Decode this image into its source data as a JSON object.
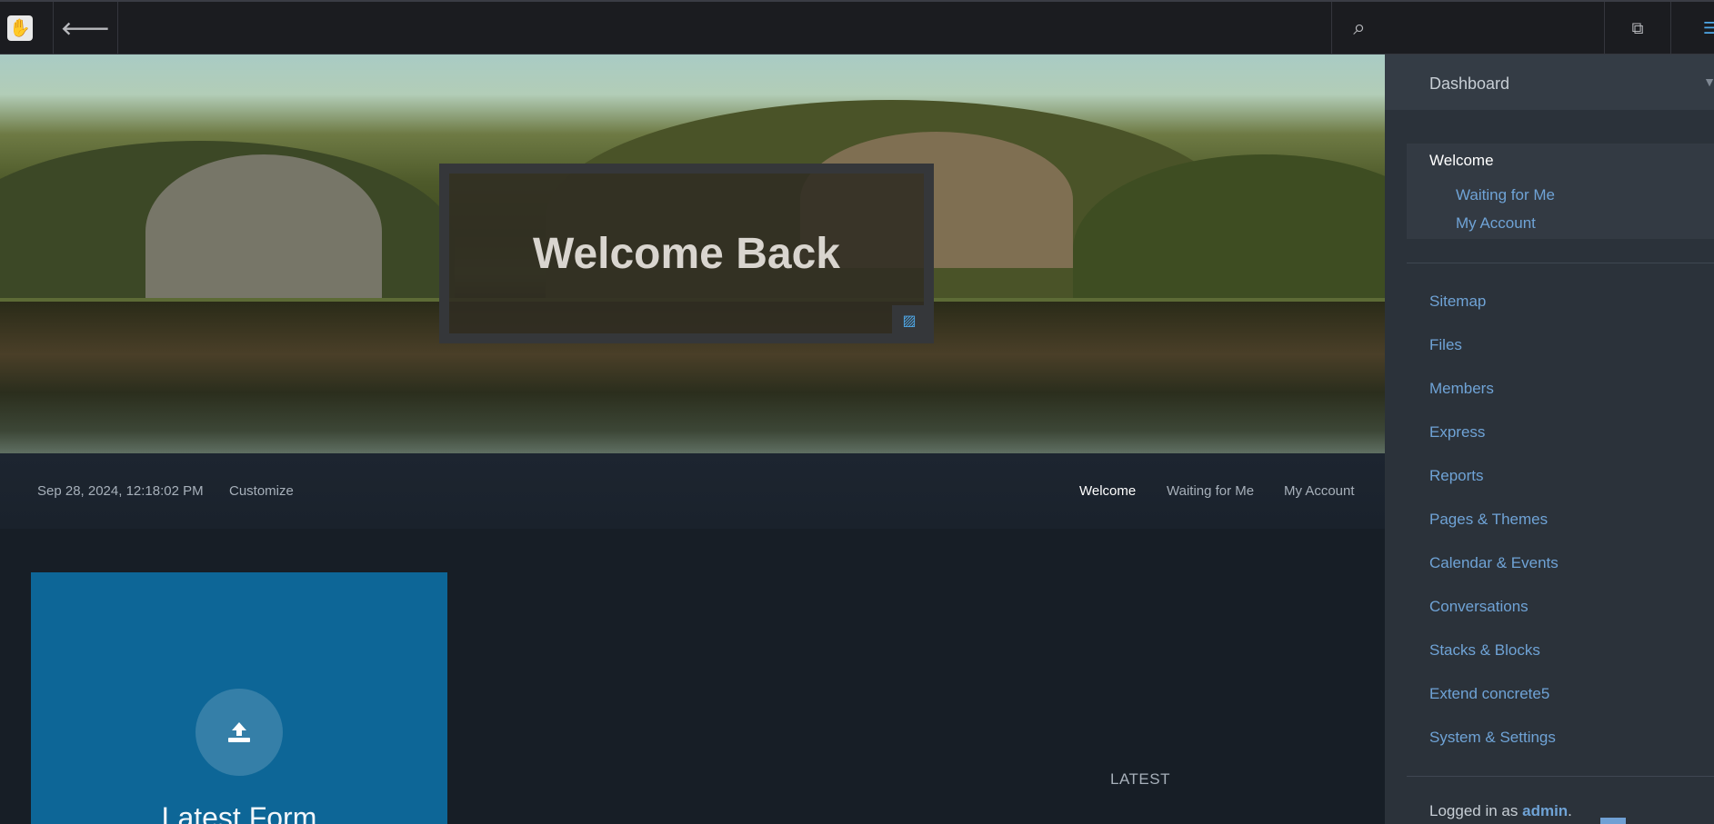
{
  "toolbar": {
    "logo_glyph": "✋",
    "back_glyph": "🡐",
    "search_glyph": "⌕",
    "copy_glyph": "⧉",
    "settings_glyph": "☰"
  },
  "hero": {
    "title": "Welcome Back",
    "image_icon": "image-icon"
  },
  "subnav": {
    "datetime": "Sep 28, 2024, 12:18:02 PM",
    "customize": "Customize",
    "tabs": [
      "Welcome",
      "Waiting for Me",
      "My Account"
    ]
  },
  "main": {
    "tile_title": "Latest Form",
    "tile_icon": "upload-icon",
    "latest_label": "LATEST"
  },
  "panel": {
    "title": "Dashboard",
    "welcome": "Welcome",
    "sub_items": [
      "Waiting for Me",
      "My Account"
    ],
    "items": [
      "Sitemap",
      "Files",
      "Members",
      "Express",
      "Reports",
      "Pages & Themes",
      "Calendar & Events",
      "Conversations",
      "Stacks & Blocks",
      "Extend concrete5",
      "System & Settings"
    ],
    "logged_in_prefix": "Logged in as",
    "logged_in_user": "admin",
    "logged_in_suffix": "."
  },
  "colors": {
    "accent": "#6fa3d6",
    "tile": "#0d6697",
    "toolbar": "#1b1c20",
    "panel": "#2b323a"
  }
}
